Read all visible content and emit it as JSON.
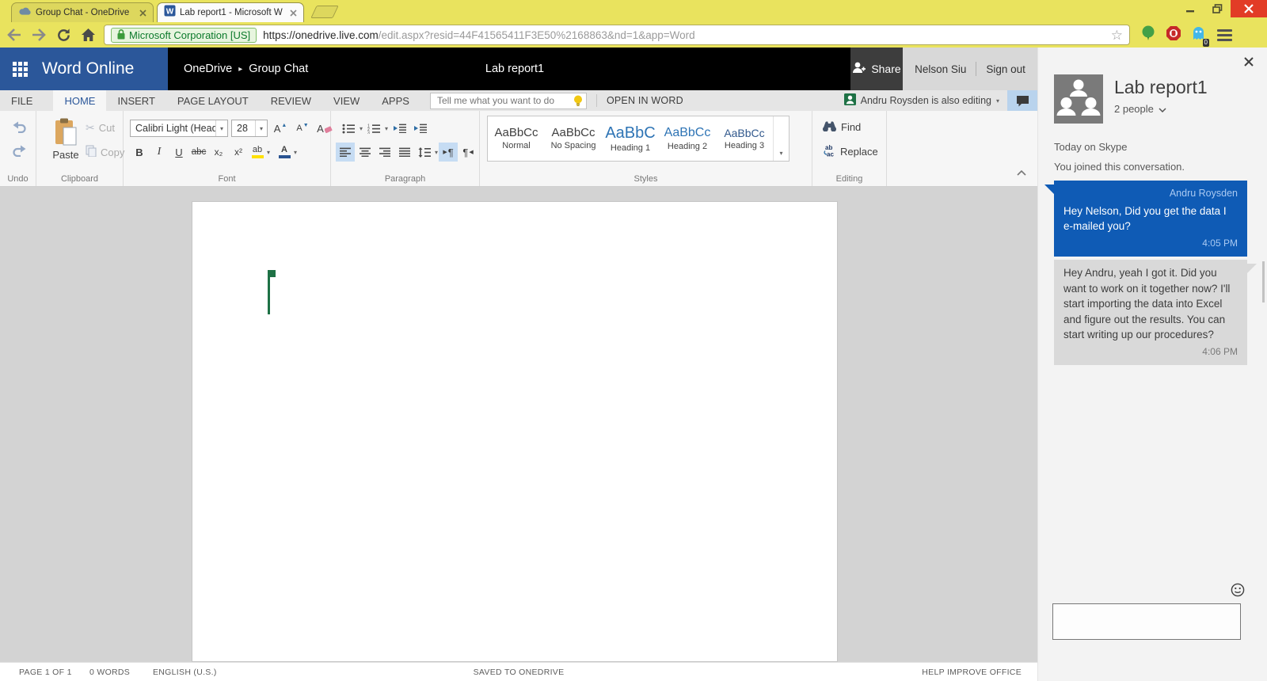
{
  "browser": {
    "tabs": [
      {
        "title": "Group Chat - OneDrive"
      },
      {
        "title": "Lab report1 - Microsoft W"
      }
    ],
    "address": {
      "ev_name": "Microsoft Corporation [US]",
      "host_part": "https://onedrive.live.com",
      "path_part": "/edit.aspx?resid=44F41565411F3E50%2168863&nd=1&app=Word"
    },
    "extension_badge": "0"
  },
  "header": {
    "app_name": "Word Online",
    "breadcrumb_root": "OneDrive",
    "breadcrumb_folder": "Group Chat",
    "doc_title": "Lab report1",
    "share_label": "Share",
    "user_name": "Nelson Siu",
    "sign_out_label": "Sign out"
  },
  "ribbon": {
    "tabs": [
      "FILE",
      "HOME",
      "INSERT",
      "PAGE LAYOUT",
      "REVIEW",
      "VIEW",
      "APPS"
    ],
    "tell_me_placeholder": "Tell me what you want to do",
    "open_in_word_label": "OPEN IN WORD",
    "coauthor_status": "Andru Roysden is also editing",
    "group_labels": {
      "undo": "Undo",
      "clipboard": "Clipboard",
      "font": "Font",
      "paragraph": "Paragraph",
      "styles": "Styles",
      "editing": "Editing"
    },
    "clipboard": {
      "paste": "Paste",
      "cut": "Cut",
      "copy": "Copy"
    },
    "font": {
      "family": "Calibri Light (Headi",
      "size": "28",
      "bold": "B",
      "italic": "I",
      "underline": "U",
      "strikethrough": "abc",
      "subscript": "x₂",
      "superscript": "x²",
      "grow": "A",
      "shrink": "A",
      "clear": "A",
      "highlight": "ab",
      "color": "A"
    },
    "styles_gallery": [
      {
        "preview": "AaBbCc",
        "name": "Normal"
      },
      {
        "preview": "AaBbCc",
        "name": "No Spacing"
      },
      {
        "preview": "AaBbC",
        "name": "Heading 1"
      },
      {
        "preview": "AaBbCc",
        "name": "Heading 2"
      },
      {
        "preview": "AaBbCc",
        "name": "Heading 3"
      }
    ],
    "editing": {
      "find": "Find",
      "replace": "Replace"
    }
  },
  "statusbar": {
    "page": "PAGE 1 OF 1",
    "words": "0 WORDS",
    "language": "ENGLISH (U.S.)",
    "saved": "SAVED TO ONEDRIVE",
    "help": "HELP IMPROVE OFFICE"
  },
  "chat": {
    "title": "Lab report1",
    "people_count": "2 people",
    "day_header": "Today on Skype",
    "joined_note": "You joined this conversation.",
    "messages": [
      {
        "sender": "Andru Roysden",
        "text": "Hey Nelson, Did you get the data I e-mailed you?",
        "time": "4:05 PM"
      },
      {
        "sender": "",
        "text": "Hey Andru, yeah I got it. Did you want to work on it together now? I'll start importing the data into Excel and figure out the results. You can start writing up our procedures?",
        "time": "4:06 PM"
      }
    ]
  },
  "colors": {
    "accent_blue": "#2b579a",
    "bubble_blue": "#0f5bb5",
    "presence_green": "#1e7145",
    "chrome_yellow": "#e9e35e"
  }
}
